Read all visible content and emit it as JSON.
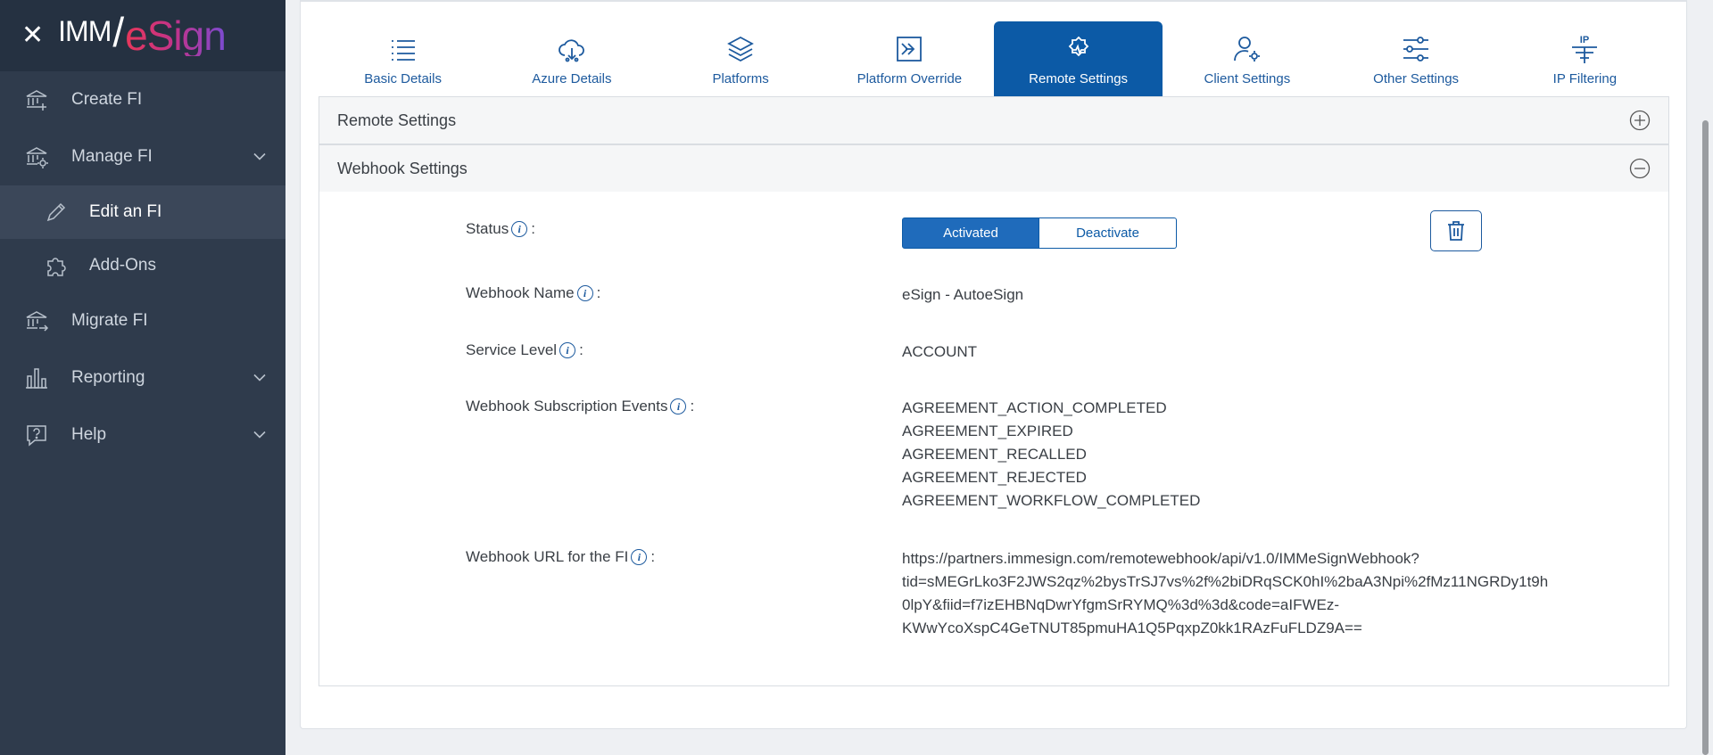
{
  "brand": {
    "imm": "IMM",
    "slash": "/",
    "esign": "eSign"
  },
  "sidebar": {
    "items": [
      {
        "label": "Create FI"
      },
      {
        "label": "Manage FI"
      },
      {
        "label": "Edit an FI"
      },
      {
        "label": "Add-Ons"
      },
      {
        "label": "Migrate FI"
      },
      {
        "label": "Reporting"
      },
      {
        "label": "Help"
      }
    ]
  },
  "tabs": [
    {
      "label": "Basic Details",
      "icon": "list-icon"
    },
    {
      "label": "Azure Details",
      "icon": "cloud-icon"
    },
    {
      "label": "Platforms",
      "icon": "layers-icon"
    },
    {
      "label": "Platform Override",
      "icon": "override-icon"
    },
    {
      "label": "Remote Settings",
      "icon": "gear-icon",
      "active": true
    },
    {
      "label": "Client Settings",
      "icon": "user-gear-icon"
    },
    {
      "label": "Other Settings",
      "icon": "sliders-icon"
    },
    {
      "label": "IP Filtering",
      "icon": "ip-filter-icon",
      "icon_text": "IP"
    }
  ],
  "panels": {
    "remote": {
      "title": "Remote Settings"
    },
    "webhook": {
      "title": "Webhook Settings"
    }
  },
  "webhook": {
    "status_label": "Status",
    "colon": ":",
    "activated_label": "Activated",
    "deactivate_label": "Deactivate",
    "name_label": "Webhook Name",
    "name_value": "eSign - AutoeSign",
    "service_label": "Service Level",
    "service_value": "ACCOUNT",
    "events_label": "Webhook Subscription Events",
    "events": [
      "AGREEMENT_ACTION_COMPLETED",
      "AGREEMENT_EXPIRED",
      "AGREEMENT_RECALLED",
      "AGREEMENT_REJECTED",
      "AGREEMENT_WORKFLOW_COMPLETED"
    ],
    "url_label": "Webhook URL for the FI",
    "url_lines": [
      "https://partners.immesign.com/remotewebhook/api/v1.0/IMMeSignWebhook?",
      "tid=sMEGrLko3F2JWS2qz%2bysTrSJ7vs%2f%2biDRqSCK0hI%2baA3Npi%2fMz11NGRDy1t9h",
      "0lpY&fiid=f7izEHBNqDwrYfgmSrRYMQ%3d%3d&code=aIFWEz-",
      "KWwYcoXspC4GeTNUT85pmuHA1Q5PqxpZ0kk1RAzFuFLDZ9A=="
    ],
    "info_glyph": "i"
  },
  "colors": {
    "sidebar": "#2f3b4c",
    "accent": "#0c5aa6"
  }
}
